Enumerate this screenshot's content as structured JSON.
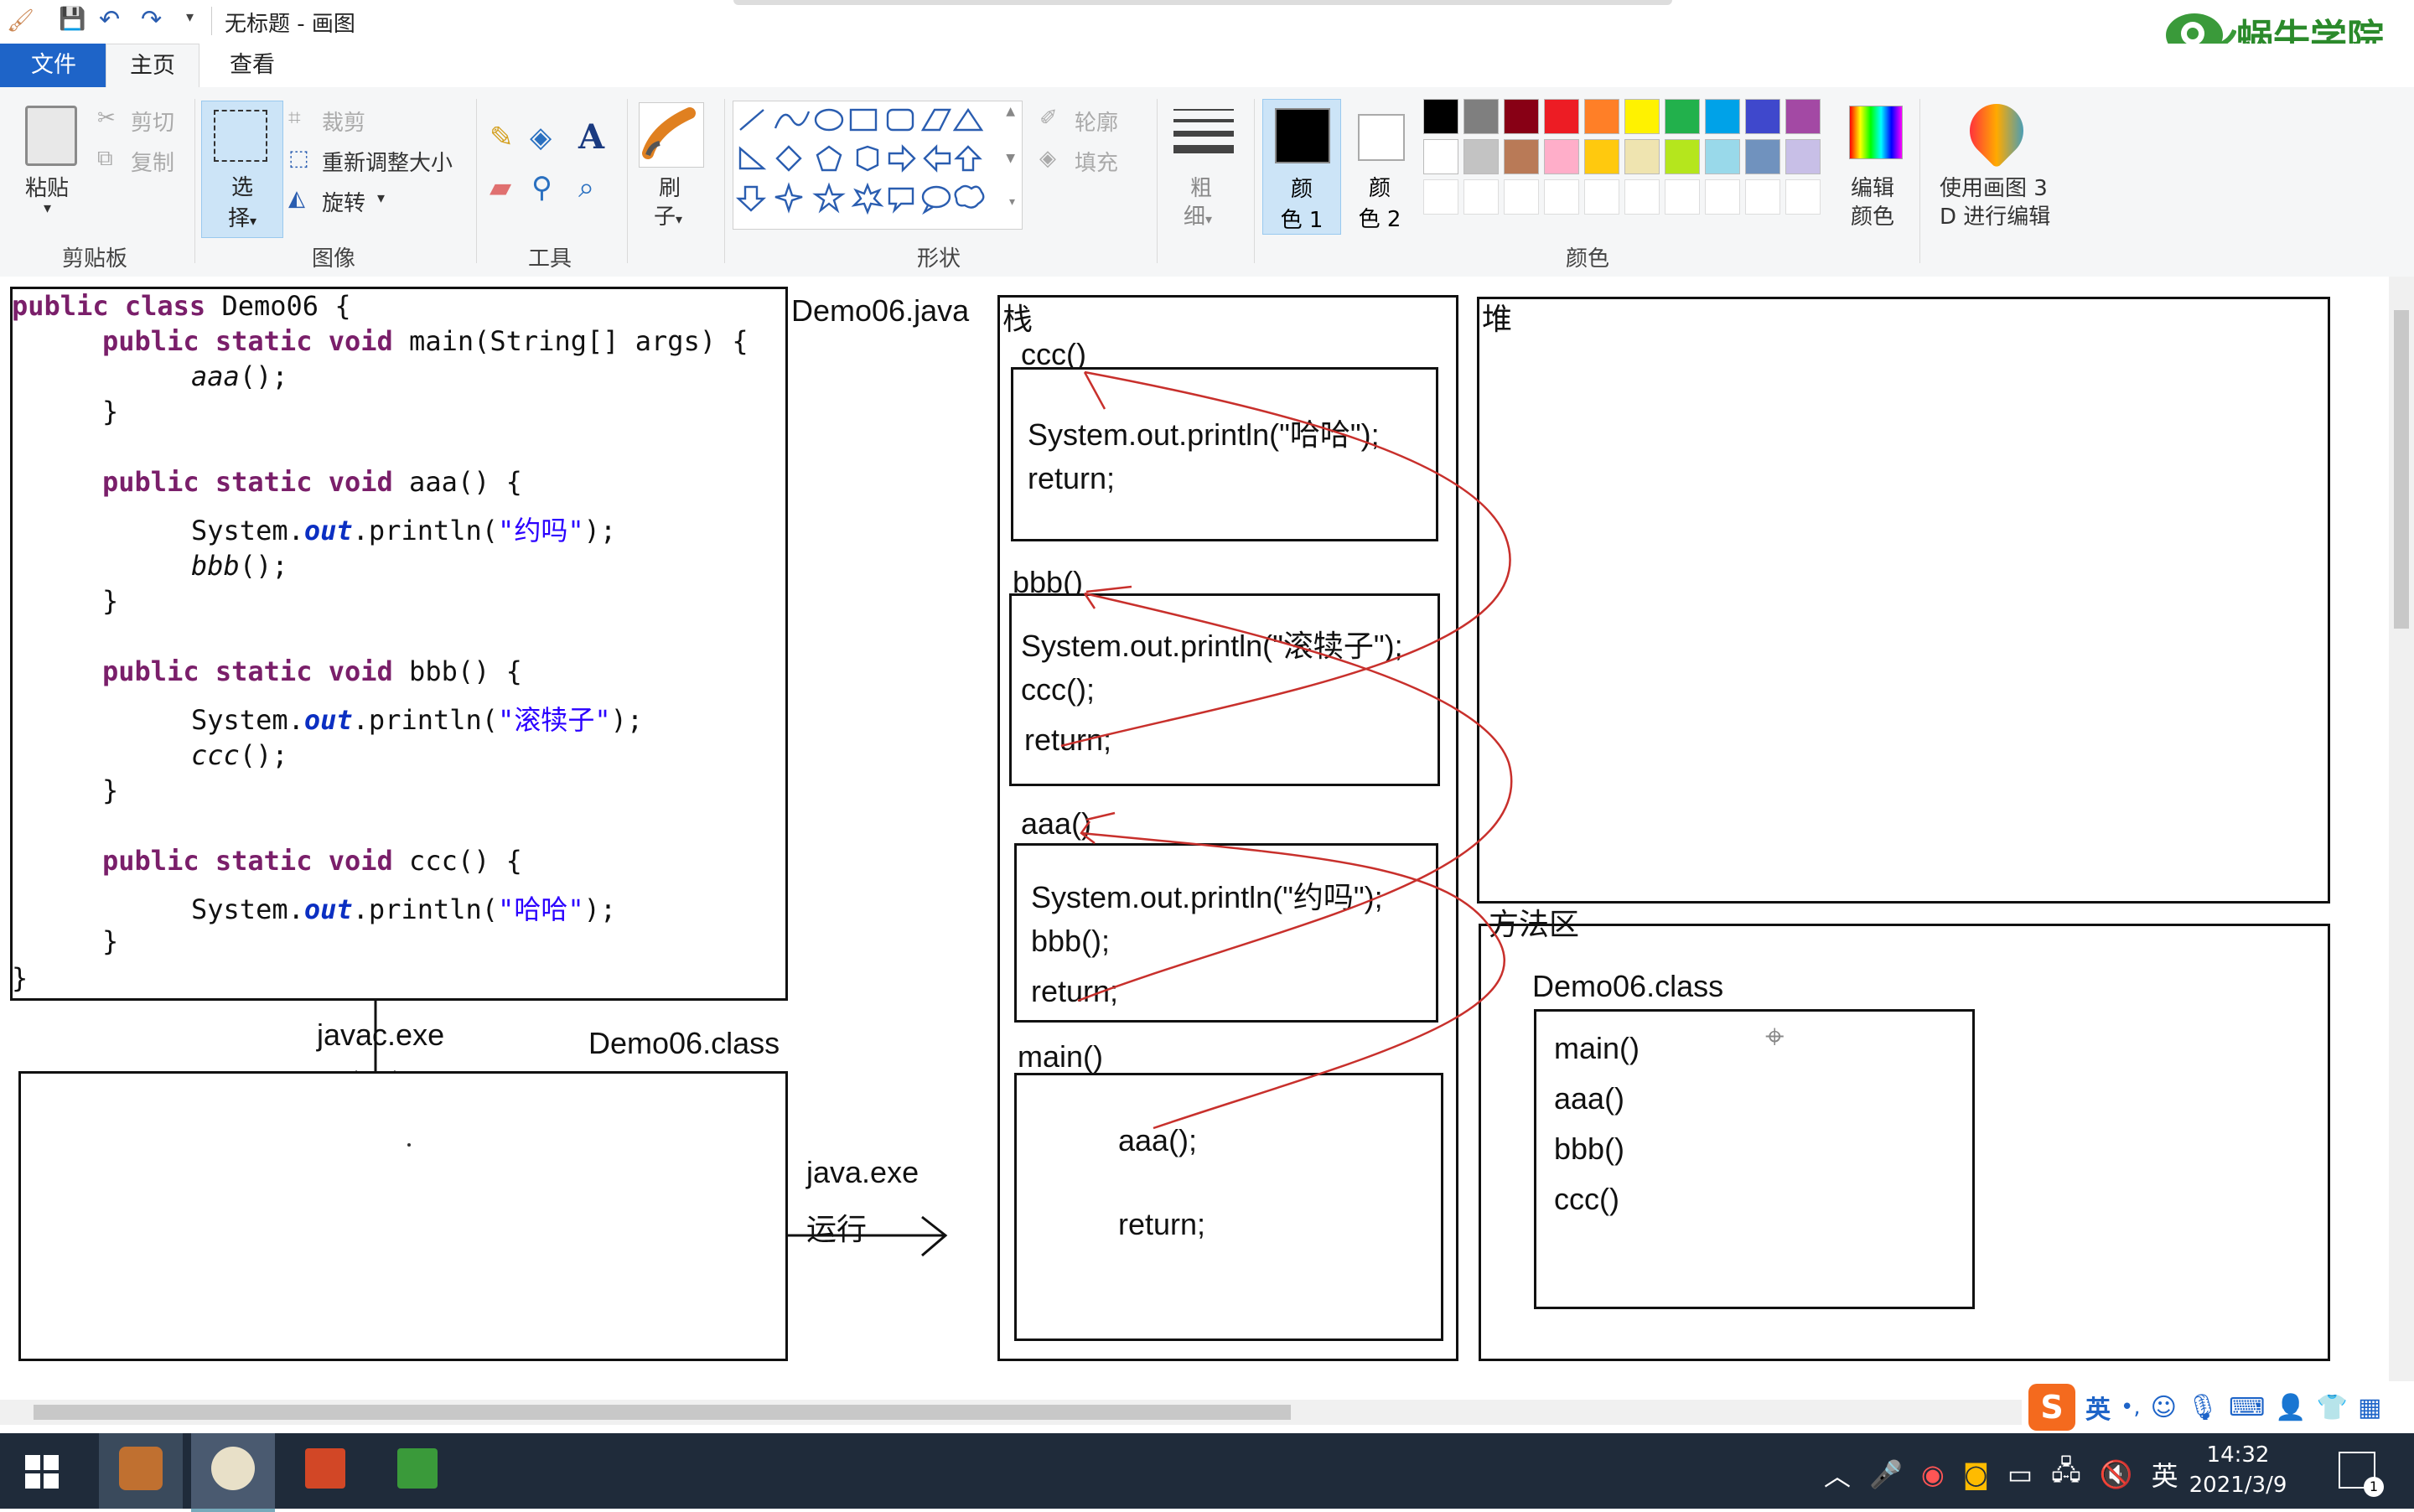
{
  "window": {
    "title": "无标题 - 画图"
  },
  "menu": {
    "file": "文件",
    "home": "主页",
    "view": "查看"
  },
  "brand": {
    "name": "蜗牛学院"
  },
  "ribbon": {
    "clipboard": {
      "paste": "粘贴",
      "cut": "剪切",
      "copy": "复制",
      "group": "剪贴板"
    },
    "image": {
      "select_a": "选",
      "select_b": "择",
      "crop": "裁剪",
      "resize": "重新调整大小",
      "rotate": "旋转",
      "group": "图像"
    },
    "tools": {
      "group": "工具",
      "text_tool": "A"
    },
    "brush": {
      "a": "刷",
      "b": "子"
    },
    "shapes": {
      "outline": "轮廓",
      "fill": "填充",
      "group": "形状"
    },
    "size": {
      "a": "粗",
      "b": "细"
    },
    "color1": {
      "a": "颜",
      "b": "色 1"
    },
    "color2": {
      "a": "颜",
      "b": "色 2"
    },
    "colors": {
      "group": "颜色",
      "edit_a": "编辑",
      "edit_b": "颜色",
      "row1": [
        "#000000",
        "#7f7f7f",
        "#880015",
        "#ed1c24",
        "#ff7f27",
        "#fff200",
        "#22b14c",
        "#00a2e8",
        "#3f48cc",
        "#a349a4"
      ],
      "row2": [
        "#ffffff",
        "#c3c3c3",
        "#b97a57",
        "#ffaec9",
        "#ffc90e",
        "#efe4b0",
        "#b5e61d",
        "#99d9ea",
        "#7092be",
        "#c8bfe7"
      ]
    },
    "paint3d": {
      "a": "使用画图 3",
      "b": "D 进行编辑"
    }
  },
  "canvas": {
    "code_lines": [
      {
        "indent": 0,
        "parts": [
          [
            "kw",
            "public class "
          ],
          [
            "t",
            "Demo06 {"
          ]
        ]
      },
      {
        "indent": 1,
        "parts": [
          [
            "kw",
            "public static void "
          ],
          [
            "t",
            "main(String[] args) {"
          ]
        ]
      },
      {
        "indent": 2,
        "parts": [
          [
            "ital",
            "aaa"
          ],
          [
            "t",
            "();"
          ]
        ]
      },
      {
        "indent": 1,
        "parts": [
          [
            "t",
            "}"
          ]
        ]
      },
      {
        "indent": 1,
        "parts": [
          [
            "kw",
            "public static void "
          ],
          [
            "t",
            "aaa() {"
          ]
        ]
      },
      {
        "indent": 2,
        "parts": [
          [
            "t",
            "System."
          ],
          [
            "field",
            "out"
          ],
          [
            "t",
            ".println("
          ],
          [
            "str",
            "\"约吗\""
          ],
          [
            "t",
            ");"
          ]
        ]
      },
      {
        "indent": 2,
        "parts": [
          [
            "ital",
            "bbb"
          ],
          [
            "t",
            "();"
          ]
        ]
      },
      {
        "indent": 1,
        "parts": [
          [
            "t",
            "}"
          ]
        ]
      },
      {
        "indent": 1,
        "parts": [
          [
            "kw",
            "public static void "
          ],
          [
            "t",
            "bbb() {"
          ]
        ]
      },
      {
        "indent": 2,
        "parts": [
          [
            "t",
            "System."
          ],
          [
            "field",
            "out"
          ],
          [
            "t",
            ".println("
          ],
          [
            "str",
            "\"滚犊子\""
          ],
          [
            "t",
            ");"
          ]
        ]
      },
      {
        "indent": 2,
        "parts": [
          [
            "ital",
            "ccc"
          ],
          [
            "t",
            "();"
          ]
        ]
      },
      {
        "indent": 1,
        "parts": [
          [
            "t",
            "}"
          ]
        ]
      },
      {
        "indent": 1,
        "parts": [
          [
            "kw",
            "public static void "
          ],
          [
            "t",
            "ccc() {"
          ]
        ]
      },
      {
        "indent": 2,
        "parts": [
          [
            "t",
            "System."
          ],
          [
            "field",
            "out"
          ],
          [
            "t",
            ".println("
          ],
          [
            "str",
            "\"哈哈\""
          ],
          [
            "t",
            ");"
          ]
        ]
      },
      {
        "indent": 1,
        "parts": [
          [
            "t",
            "}"
          ]
        ]
      },
      {
        "indent": 0,
        "parts": [
          [
            "t",
            "}"
          ]
        ]
      }
    ],
    "labels": {
      "demo_java": "Demo06.java",
      "javac": "javac.exe",
      "demo_class": "Demo06.class",
      "java_exe": "java.exe",
      "run": "运行",
      "stack": "栈",
      "heap": "堆",
      "method_area": "方法区",
      "method_area_class": "Demo06.class"
    },
    "frames": {
      "ccc": {
        "name": "ccc()",
        "lines": [
          "System.out.println(\"哈哈\");",
          "return;"
        ]
      },
      "bbb": {
        "name": "bbb()",
        "lines": [
          "System.out.println(\"滚犊子\");",
          "ccc();",
          "return;"
        ]
      },
      "aaa": {
        "name": "aaa()",
        "lines": [
          "System.out.println(\"约吗\");",
          "bbb();",
          "return;"
        ]
      },
      "main": {
        "name": "main()",
        "lines": [
          "aaa();",
          "return;"
        ]
      }
    },
    "methods": [
      "main()",
      "aaa()",
      "bbb()",
      "ccc()"
    ]
  },
  "taskbar": {
    "time": "14:32",
    "date": "2021/3/9",
    "ime": "英",
    "notif": "1"
  }
}
